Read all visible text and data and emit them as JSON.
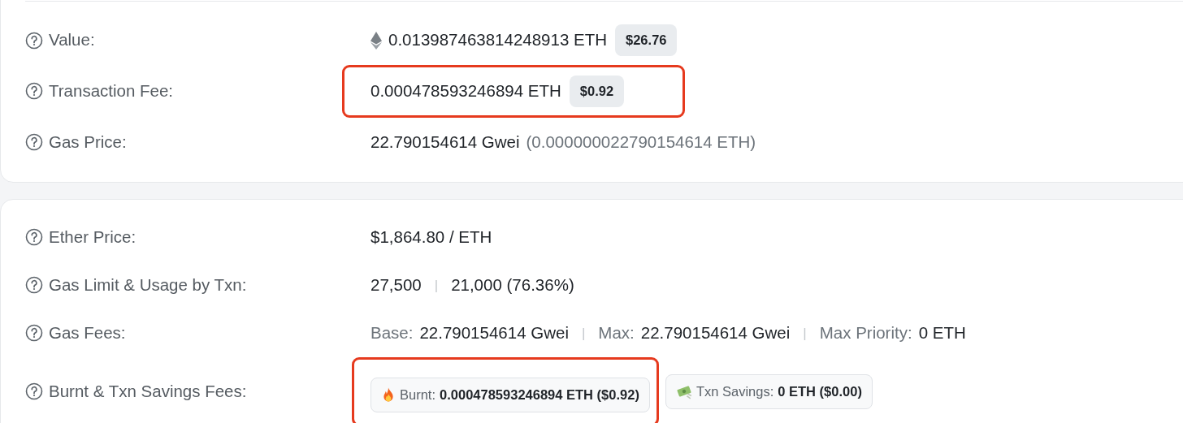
{
  "cards": [
    {
      "rows": [
        {
          "label": "Value:",
          "highlighted": false,
          "value": [
            {
              "kind": "symbol"
            },
            {
              "kind": "text",
              "text": "0.013987463814248913 ETH"
            },
            {
              "kind": "pill",
              "text": "$26.76"
            }
          ]
        },
        {
          "label": "Transaction Fee:",
          "highlighted": true,
          "value": [
            {
              "kind": "text",
              "text": "0.000478593246894 ETH"
            },
            {
              "kind": "pill",
              "text": "$0.92"
            }
          ]
        },
        {
          "label": "Gas Price:",
          "highlighted": false,
          "value": [
            {
              "kind": "text",
              "text": "22.790154614 Gwei"
            },
            {
              "kind": "muted",
              "text": "(0.000000022790154614 ETH)"
            }
          ]
        }
      ]
    },
    {
      "rows": [
        {
          "label": "Ether Price:",
          "highlighted": false,
          "value": [
            {
              "kind": "text",
              "text": "$1,864.80 / ETH"
            }
          ]
        },
        {
          "label": "Gas Limit & Usage by Txn:",
          "highlighted": false,
          "value": [
            {
              "kind": "text",
              "text": "27,500"
            },
            {
              "kind": "divider",
              "text": "|"
            },
            {
              "kind": "text",
              "text": "21,000 (76.36%)"
            }
          ]
        },
        {
          "label": "Gas Fees:",
          "highlighted": false,
          "value": [
            {
              "kind": "muted",
              "text": "Base:"
            },
            {
              "kind": "text",
              "text": "22.790154614 Gwei"
            },
            {
              "kind": "divider",
              "text": "|"
            },
            {
              "kind": "muted",
              "text": "Max:"
            },
            {
              "kind": "text",
              "text": "22.790154614 Gwei"
            },
            {
              "kind": "divider",
              "text": "|"
            },
            {
              "kind": "muted",
              "text": "Max Priority:"
            },
            {
              "kind": "text",
              "text": "0 ETH"
            }
          ]
        },
        {
          "label": "Burnt & Txn Savings Fees:",
          "highlighted": true,
          "value": [
            {
              "kind": "burnt-chip",
              "label": "Burnt:",
              "text": "0.000478593246894 ETH ($0.92)"
            }
          ],
          "extra": [
            {
              "kind": "savings-chip",
              "label": "Txn Savings:",
              "text": "0 ETH ($0.00)"
            }
          ]
        }
      ]
    }
  ]
}
